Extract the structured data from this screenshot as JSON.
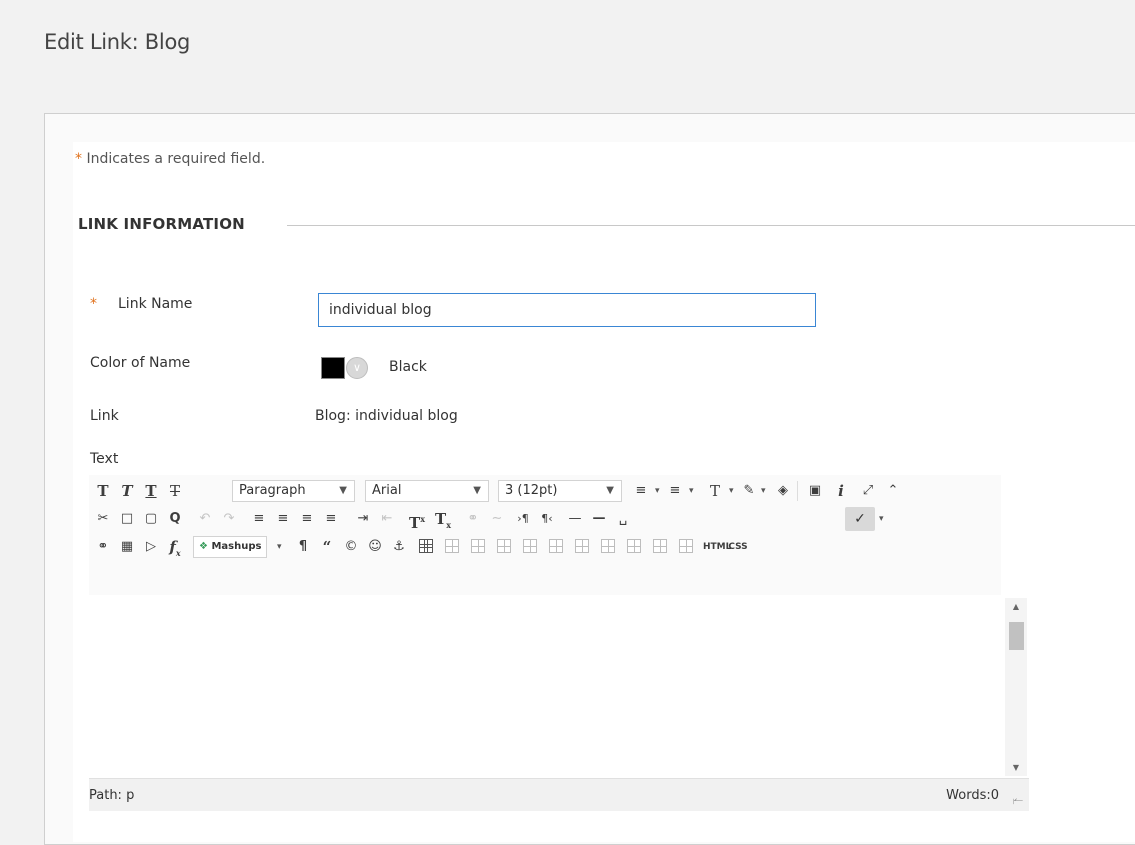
{
  "page": {
    "title": "Edit Link: Blog"
  },
  "form": {
    "required_star": "*",
    "required_note": "Indicates a required field.",
    "section_title": "LINK INFORMATION",
    "link_name": {
      "star": "*",
      "label": "Link Name",
      "value": "individual blog"
    },
    "color_of_name": {
      "label": "Color of Name",
      "value": "Black",
      "swatch_color": "#000000"
    },
    "link": {
      "label": "Link",
      "value": "Blog: individual blog"
    },
    "text": {
      "label": "Text"
    }
  },
  "editor": {
    "format_select": "Paragraph",
    "font_select": "Arial",
    "size_select": "3 (12pt)",
    "mashups_label": "Mashups",
    "html_label": "HTML",
    "css_label": "CSS",
    "path": "Path: p",
    "words": "Words:0"
  }
}
